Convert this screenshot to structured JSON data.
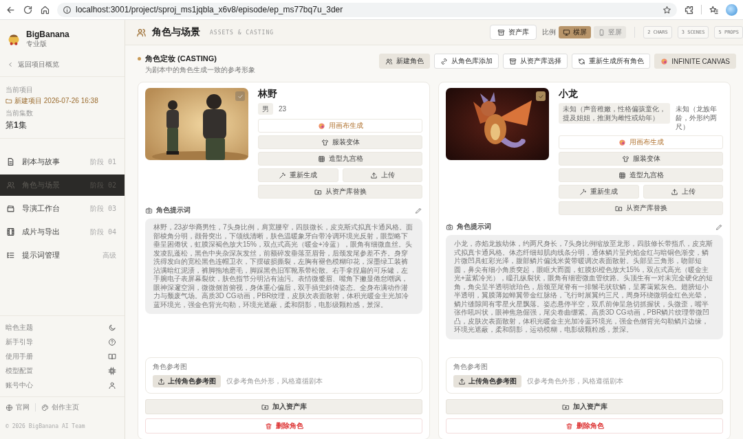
{
  "browser": {
    "url": "localhost:3001/project/sproj_ms1jqbla_x6v8/episode/ep_ms77bq7u_3der"
  },
  "sidebar": {
    "brand": "BigBanana",
    "edition": "专业版",
    "back_link": "返回项目概览",
    "project_label": "当前项目",
    "project_name": "新建项目 2026-07-26 16:38",
    "episode_label": "当前集数",
    "episode": "第**1**集",
    "nav": [
      {
        "label": "剧本与故事",
        "stage": "阶段 01",
        "selected": false
      },
      {
        "label": "角色与场景",
        "stage": "阶段 02",
        "selected": true
      },
      {
        "label": "导演工作台",
        "stage": "阶段 03",
        "selected": false
      },
      {
        "label": "成片与导出",
        "stage": "阶段 04",
        "selected": false
      },
      {
        "label": "提示词管理",
        "stage": "高级",
        "selected": false
      }
    ],
    "settings": [
      "暗色主题",
      "新手引导",
      "使用手册",
      "模型配置",
      "账号中心"
    ],
    "links": [
      "官网",
      "创作主页"
    ],
    "copyright": "© 2026 BigBanana AI Team"
  },
  "header": {
    "title": "角色与场景",
    "subtitle": "ASSETS & CASTING",
    "library_button": "资产库",
    "ratio_label": "比例",
    "ratios": [
      {
        "label": "横屏",
        "selected": true
      },
      {
        "label": "竖屏",
        "selected": false
      }
    ],
    "stats": [
      "2 CHARS",
      "3 SCENES",
      "5 PROPS"
    ]
  },
  "section": {
    "title": "角色定妆 (CASTING)",
    "description": "为剧本中的角色生成一致的参考形象",
    "actions": [
      {
        "label": "新建角色",
        "kind": "tinted"
      },
      {
        "label": "从角色库添加",
        "kind": "outline"
      },
      {
        "label": "从资产库选择",
        "kind": "outline"
      },
      {
        "label": "重新生成所有角色",
        "kind": "outline"
      },
      {
        "label": "INFINITE CANVAS",
        "kind": "tinted"
      }
    ]
  },
  "characters": [
    {
      "name": "林野",
      "gender": "男",
      "age": "23",
      "actions": [
        {
          "label": "用画布生成",
          "kind": "canvas"
        },
        {
          "label": "服装变体",
          "kind": "full"
        },
        {
          "label": "造型九宫格",
          "kind": "full"
        },
        {
          "label": "重新生成",
          "kind": "half"
        },
        {
          "label": "上传",
          "kind": "half"
        },
        {
          "label": "从资产库替换",
          "kind": "full"
        }
      ],
      "prompt_label": "角色提示词",
      "prompt": "林野，23岁华裔男性，7头身比例，肩宽腰窄，四肢微长，皮克斯式拟真卡通风格。面部棱角分明，颧骨突出，下颌线清晰，肤色温暖象牙白带冷调环境光反射，眼型略下垂呈困倦状，虹膜深褐色放大15%，双点式高光（暖金+冷蓝），眼角有细微血丝。头发凌乱蓬松，黑色中夹杂深灰发丝，前额碎发垂落至眉骨，后颈发尾参差不齐。身穿洗得发白的宽松黑色连帽卫衣，下摆破损撕裂，左胸有褪色模糊印花，深墨绿工装裤沾满暗红泥渍，裤脚拖地磨毛，脚踩黑色旧军靴系带松散。右手拿捏扁的可乐罐，左手腕电子表屏幕裂纹，肤色指节分明沾有油污。表情微蹙眉、嘴角下撇显倦怠嘲讽，眼神深邃空洞，微微侧首俯视，身体重心偏后，双手插兜斜倚姿态。全身布满动作潜力与颓废气场。高质3D CG动画，PBR纹理，皮肤次表面散射，体积光暖金主光加冷蓝环境光，强金色背光勾勒，环境光遮蔽，柔和阴影，电影级颗粒感，景深。",
      "reference_label": "角色参考图",
      "upload_button": "上传角色参考图",
      "reference_hint": "仅参考角色外形，风格遵循剧本",
      "add_button": "加入资产库",
      "delete_button": "删除角色"
    },
    {
      "name": "小龙",
      "gender": "未知（声音稚嫩，性格偏孩童化，提及姐姐，推测为雌性或幼年）",
      "age": "未知（龙族年龄，外形约两尺）",
      "actions": [
        {
          "label": "用画布生成",
          "kind": "canvas"
        },
        {
          "label": "服装变体",
          "kind": "full"
        },
        {
          "label": "造型九宫格",
          "kind": "full"
        },
        {
          "label": "重新生成",
          "kind": "half"
        },
        {
          "label": "上传",
          "kind": "half"
        },
        {
          "label": "从资产库替换",
          "kind": "full"
        }
      ],
      "prompt_label": "角色提示词",
      "prompt": "小龙，赤焰龙族幼体，约两尺身长，7头身比例缩放至龙形，四肢修长带指爪，皮克斯式拟真卡通风格。体态纤细却肌肉线条分明，通体鳞片呈灼焰金红与暗铜色渐变，鳞片微凹具虹彩光泽，腹部鳞片偏浅米黄带暖调次表面散射。头部呈三角形，吻部短圆，鼻尖有细小角质突起，眼眶大而圆，虹膜炽橙色放大15%，双点式高光（暖金主光+蓝紫冷光），瞳孔纵裂状，眼角有细密微血管纹路。头顶生有一对未完全硬化的短角，角尖呈半透明琥珀色，后颈至尾脊有一排鬃毛状软鳞，呈雾霭紫灰色。翅膀短小半透明，翼膜薄如蝉翼带金红脉络，飞行时展翼约三尺，周身环绕微弱金红色光晕，鳞片缝隙间有零星火星飘落。姿态悬停半空，双爪前伸呈急切抓握状，头微歪，嘴半张作吼叫状，眼神焦急倔强，尾尖卷曲绷紧。高质3D CG动画，PBR鳞片纹理带微凹凸，皮肤次表面散射，体积光暖金主光加冷蓝环境光，强金色侧背光勾勒鳞片边缘，环境光遮蔽，柔和阴影，运动模糊，电影级颗粒感，景深。",
      "reference_label": "角色参考图",
      "upload_button": "上传角色参考图",
      "reference_hint": "仅参考角色外形，风格遵循剧本",
      "add_button": "加入资产库",
      "delete_button": "删除角色"
    }
  ]
}
